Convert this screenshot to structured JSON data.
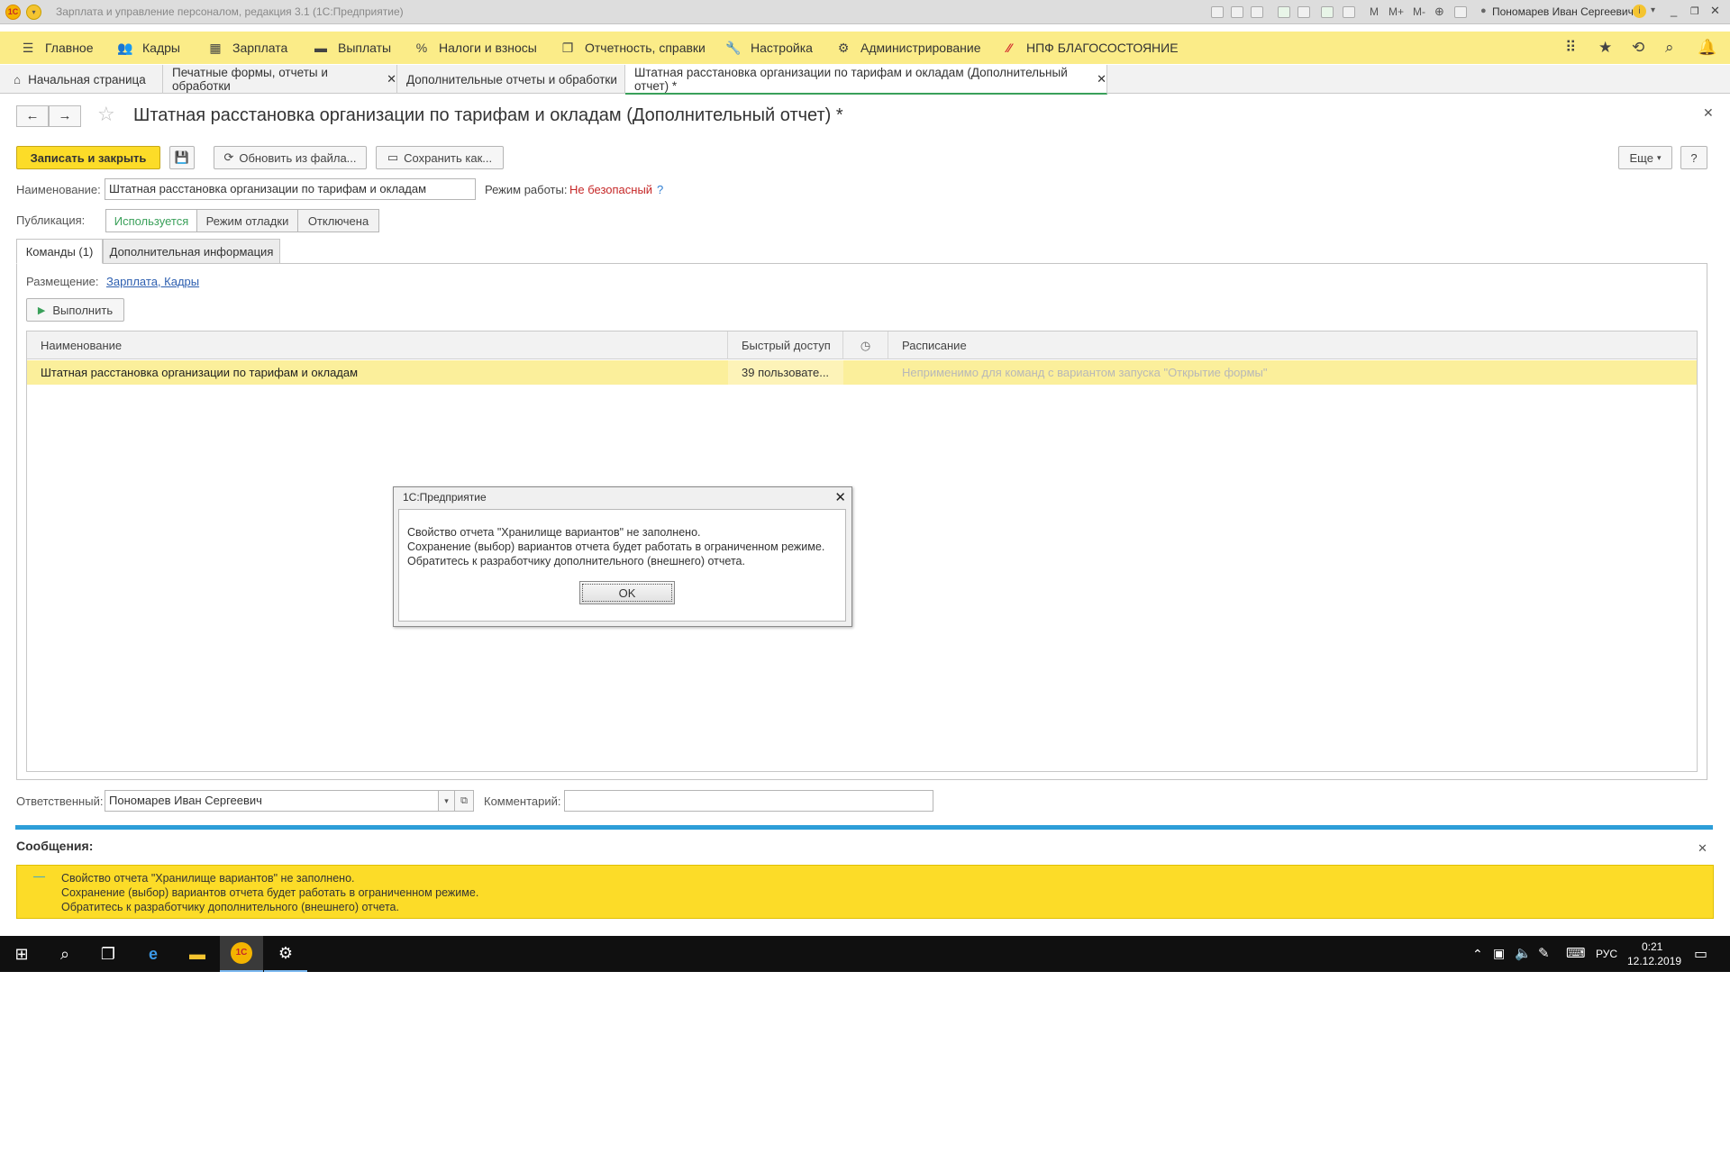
{
  "window": {
    "title": "Зарплата и управление персоналом, редакция 3.1  (1С:Предприятие)",
    "user": "Пономарев Иван Сергеевич",
    "toolbar_letters": [
      "M",
      "M+",
      "M-"
    ]
  },
  "menu": [
    {
      "label": "Главное",
      "icon": "hamburger-icon"
    },
    {
      "label": "Кадры",
      "icon": "people-icon"
    },
    {
      "label": "Зарплата",
      "icon": "calculator-icon"
    },
    {
      "label": "Выплаты",
      "icon": "wallet-icon"
    },
    {
      "label": "Налоги и взносы",
      "icon": "percent-icon"
    },
    {
      "label": "Отчетность, справки",
      "icon": "documents-icon"
    },
    {
      "label": "Настройка",
      "icon": "wrench-icon"
    },
    {
      "label": "Администрирование",
      "icon": "gear-icon"
    },
    {
      "label": "НПФ БЛАГОСОСТОЯНИЕ",
      "icon": "npf-icon"
    }
  ],
  "tabs": [
    {
      "label": "Начальная страница"
    },
    {
      "label": "Печатные формы, отчеты и обработки"
    },
    {
      "label": "Дополнительные отчеты и обработки"
    },
    {
      "label": "Штатная расстановка организации по тарифам и окладам (Дополнительный отчет) *"
    }
  ],
  "form": {
    "title": "Штатная расстановка организации по тарифам и окладам (Дополнительный отчет) *",
    "save_close": "Записать и закрыть",
    "update_from_file": "Обновить из файла...",
    "save_as": "Сохранить как...",
    "more": "Еще",
    "help": "?",
    "name_label": "Наименование:",
    "name_value": "Штатная расстановка организации по тарифам и окладам",
    "mode_label": "Режим работы:",
    "mode_value": "Не безопасный",
    "mode_help": "?",
    "publication_label": "Публикация:",
    "publication_options": [
      "Используется",
      "Режим отладки",
      "Отключена"
    ],
    "form_tabs": [
      "Команды (1)",
      "Дополнительная информация"
    ],
    "placement_label": "Размещение:",
    "placement_value": "Зарплата, Кадры",
    "run_button": "Выполнить",
    "responsible_label": "Ответственный:",
    "responsible_value": "Пономарев Иван Сергеевич",
    "comment_label": "Комментарий:",
    "comment_value": ""
  },
  "grid": {
    "columns": [
      "Наименование",
      "Быстрый доступ",
      "",
      "Расписание"
    ],
    "rows": [
      {
        "name": "Штатная расстановка организации по тарифам и окладам",
        "quick_access": "39 пользовате...",
        "schedule": "Неприменимо для команд с вариантом запуска \"Открытие формы\""
      }
    ]
  },
  "dialog": {
    "title": "1С:Предприятие",
    "lines": [
      "Свойство отчета \"Хранилище вариантов\" не заполнено.",
      "Сохранение (выбор) вариантов отчета будет работать в ограниченном режиме.",
      "Обратитесь к разработчику дополнительного (внешнего) отчета."
    ],
    "ok": "OK"
  },
  "messages": {
    "header": "Сообщения:",
    "dash": "—",
    "lines": [
      "Свойство отчета \"Хранилище вариантов\" не заполнено.",
      "Сохранение (выбор) вариантов отчета будет работать в ограниченном режиме.",
      "Обратитесь к разработчику дополнительного (внешнего) отчета."
    ]
  },
  "taskbar": {
    "lang": "РУС",
    "time": "0:21",
    "date": "12.12.2019"
  },
  "colors": {
    "menu_bg": "#fbec88",
    "accent_yellow": "#fcdc28",
    "message_blue": "#2d9ed8",
    "mode_red": "#c62828"
  }
}
